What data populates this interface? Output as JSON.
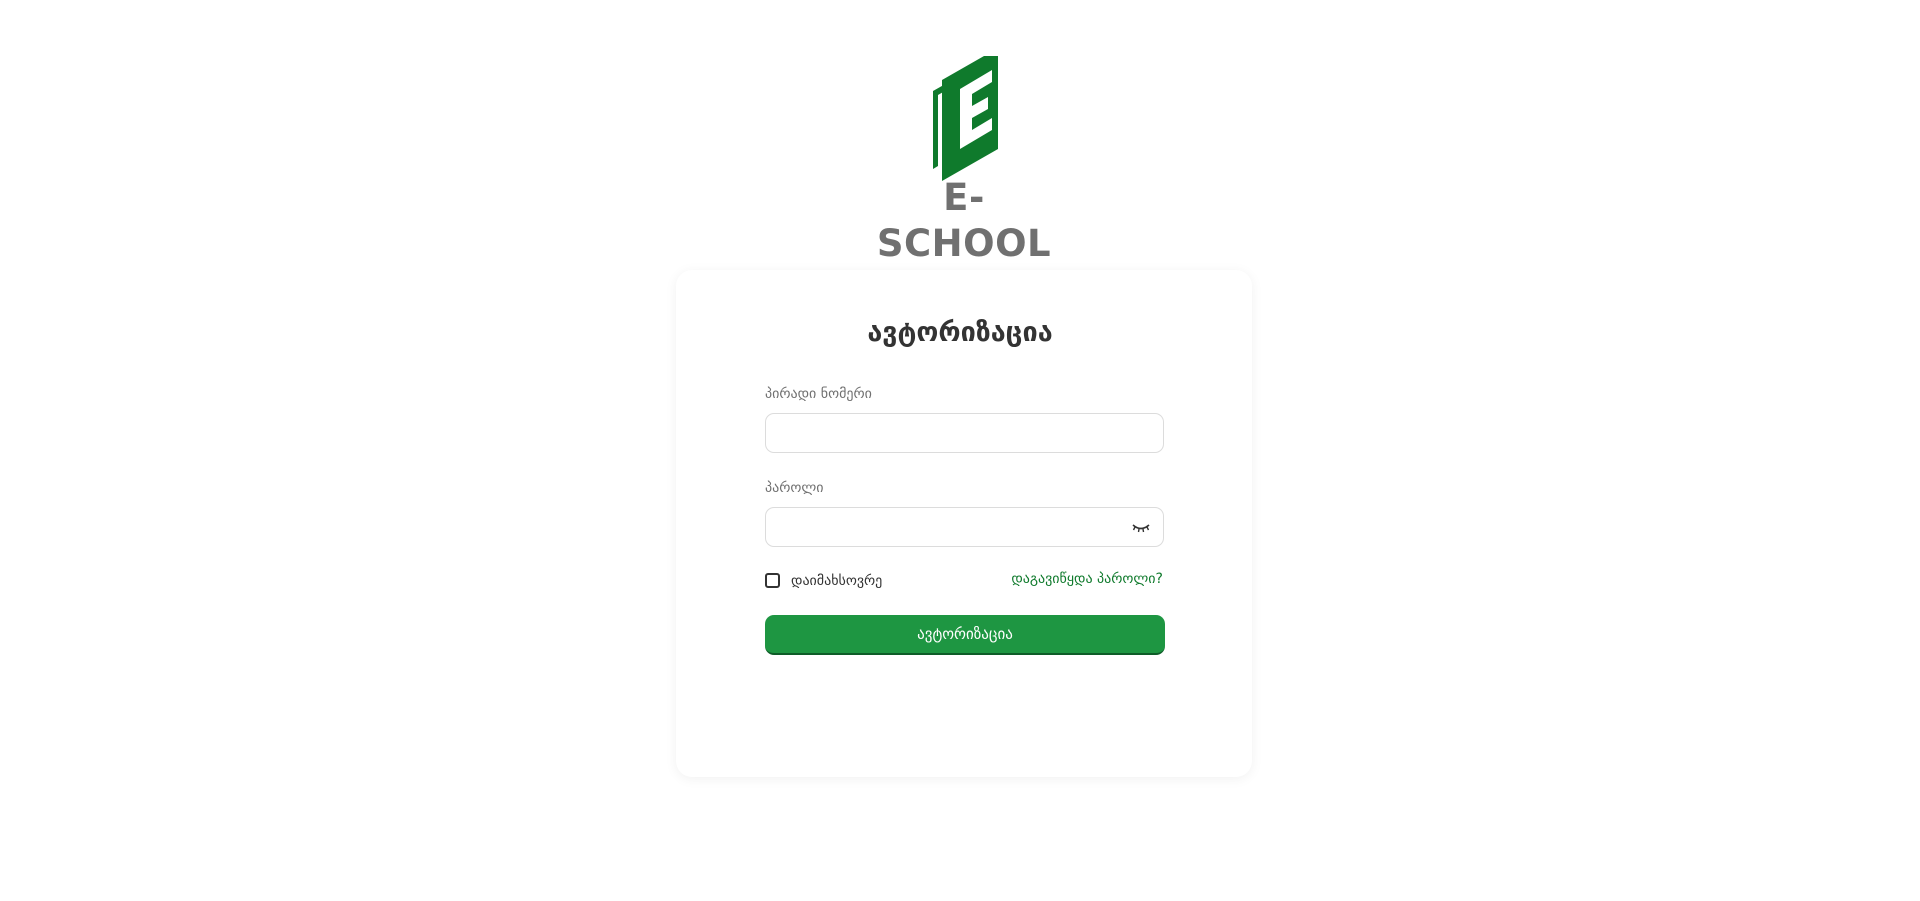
{
  "brand": {
    "name": "E-SCHOOL",
    "color_primary": "#0f7a2c",
    "color_text": "#707070"
  },
  "login_form": {
    "title": "ავტორიზაცია",
    "personal_number_label": "პირადი ნომერი",
    "personal_number_value": "",
    "password_label": "პაროლი",
    "password_value": "",
    "remember_label": "დაიმახსოვრე",
    "remember_checked": false,
    "forgot_link": "დაგავიწყდა პაროლი?",
    "submit_label": "ავტორიზაცია"
  },
  "icons": {
    "password_toggle": "eye-closed-icon"
  },
  "colors": {
    "button_bg": "#1e9642",
    "link": "#0f7a2c"
  }
}
